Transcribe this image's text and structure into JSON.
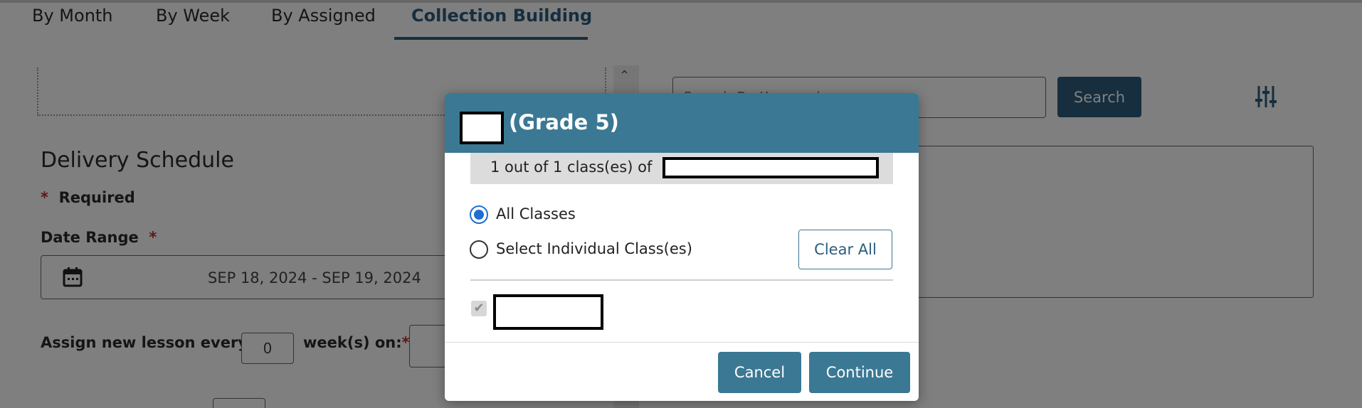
{
  "tabs": [
    {
      "label": "By Month",
      "active": false
    },
    {
      "label": "By Week",
      "active": false
    },
    {
      "label": "By Assigned",
      "active": false
    },
    {
      "label": "Collection Building",
      "active": true
    }
  ],
  "schedule": {
    "title": "Delivery Schedule",
    "required_marker": "*",
    "required_label": "Required",
    "date_range_label": "Date Range",
    "date_range_value": "SEP 18, 2024 - SEP 19, 2024",
    "assign_label": "Assign new lesson every",
    "assign_value": "0",
    "weeks_label": "week(s)  on:"
  },
  "search": {
    "placeholder": "Search By Keyword",
    "button_label": "Search"
  },
  "icons": {
    "calendar": "calendar-icon",
    "filter": "sliders-filter-icon",
    "scroll_up": "chevron-up-icon",
    "check": "check-icon"
  },
  "modal": {
    "title": "(Grade 5)",
    "count_text": "1 out of 1 class(es) of",
    "options": [
      {
        "label": "All Classes",
        "checked": true
      },
      {
        "label": "Select Individual Class(es)",
        "checked": false
      }
    ],
    "clear_all_label": "Clear All",
    "cancel_label": "Cancel",
    "continue_label": "Continue"
  },
  "colors": {
    "primary": "#2c5d7c",
    "modal_header": "#3b7894",
    "radio_selected": "#1f6fd1",
    "required": "#c62828",
    "overlay": "rgba(0,0,0,0.5)"
  }
}
